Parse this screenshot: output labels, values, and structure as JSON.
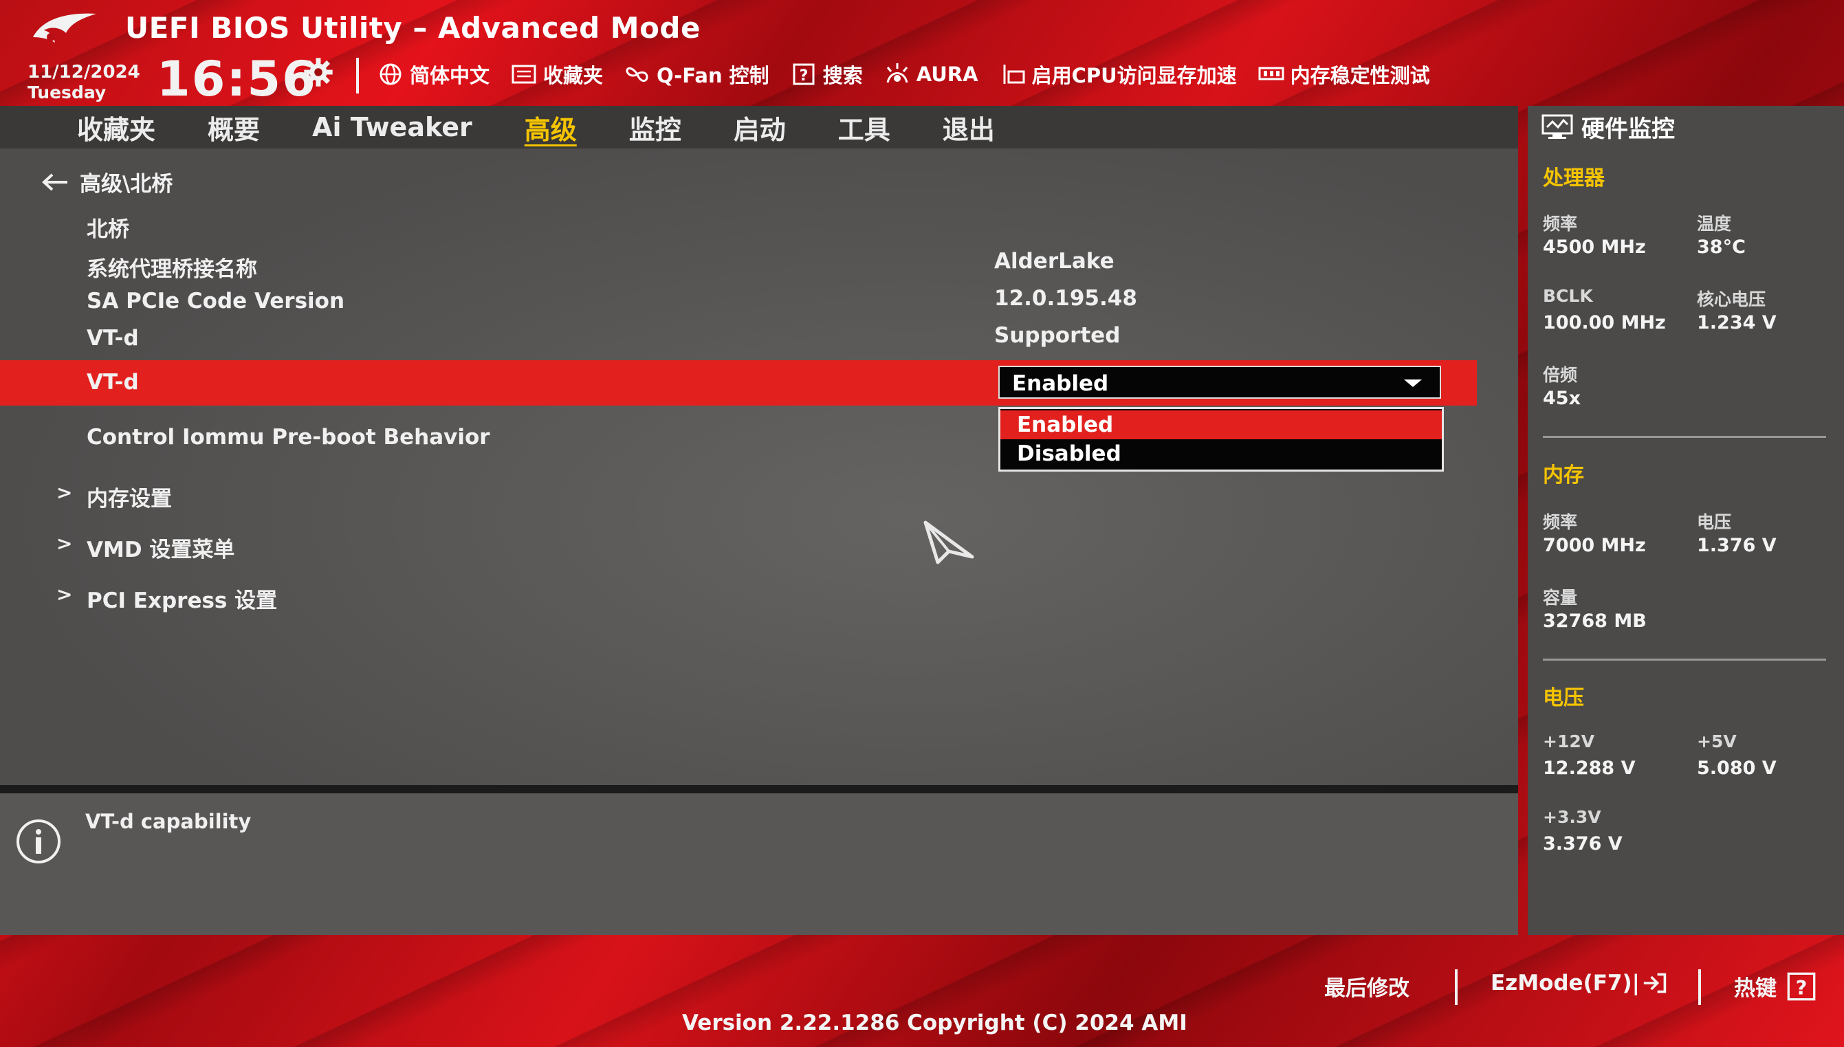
{
  "header": {
    "title": "UEFI BIOS Utility – Advanced Mode",
    "date": "11/12/2024",
    "day": "Tuesday",
    "time": "16:56",
    "toolbar": [
      {
        "icon": "globe-icon",
        "label": "简体中文"
      },
      {
        "icon": "favorites-icon",
        "label": "收藏夹"
      },
      {
        "icon": "fan-icon",
        "label": "Q-Fan 控制"
      },
      {
        "icon": "help-box-icon",
        "label": "搜索"
      },
      {
        "icon": "aura-icon",
        "label": "AURA"
      },
      {
        "icon": "cpu-memory-icon",
        "label": "启用CPU访问显存加速"
      },
      {
        "icon": "memory-icon",
        "label": "内存稳定性测试"
      }
    ]
  },
  "nav": {
    "tabs": [
      "收藏夹",
      "概要",
      "Ai Tweaker",
      "高级",
      "监控",
      "启动",
      "工具",
      "退出"
    ],
    "active_index": 3
  },
  "main": {
    "breadcrumb": "高级\\北桥",
    "section_title": "北桥",
    "info_rows": [
      {
        "label": "系统代理桥接名称",
        "value": "AlderLake"
      },
      {
        "label": "SA PCIe Code Version",
        "value": "12.0.195.48"
      },
      {
        "label": "VT-d",
        "value": "Supported"
      }
    ],
    "selected_row": {
      "label": "VT-d",
      "value": "Enabled"
    },
    "dropdown_options": [
      "Enabled",
      "Disabled"
    ],
    "iommu_row": {
      "label": "Control Iommu Pre-boot Behavior"
    },
    "submenus": [
      "内存设置",
      "VMD 设置菜单",
      "PCI Express 设置"
    ],
    "submenu_arrow": ">",
    "help_text": "VT-d capability"
  },
  "hw_monitor": {
    "title": "硬件监控",
    "cpu": {
      "section": "处理器",
      "freq_label": "频率",
      "freq": "4500 MHz",
      "temp_label": "温度",
      "temp": "38°C",
      "bclk_label": "BCLK",
      "bclk": "100.00 MHz",
      "vcore_label": "核心电压",
      "vcore": "1.234 V",
      "ratio_label": "倍频",
      "ratio": "45x"
    },
    "memory": {
      "section": "内存",
      "freq_label": "频率",
      "freq": "7000 MHz",
      "volt_label": "电压",
      "volt": "1.376 V",
      "cap_label": "容量",
      "cap": "32768 MB"
    },
    "voltage": {
      "section": "电压",
      "v12_label": "+12V",
      "v12": "12.288 V",
      "v5_label": "+5V",
      "v5": "5.080 V",
      "v33_label": "+3.3V",
      "v33": "3.376 V"
    }
  },
  "footer": {
    "last_modified": "最后修改",
    "ezmode": "EzMode(F7)|",
    "hotkeys": "热键",
    "version": "Version 2.22.1286 Copyright (C) 2024 AMI"
  },
  "colors": {
    "accent_red": "#e2211e",
    "active_tab": "#f5c400",
    "section_heading": "#f5c400"
  }
}
